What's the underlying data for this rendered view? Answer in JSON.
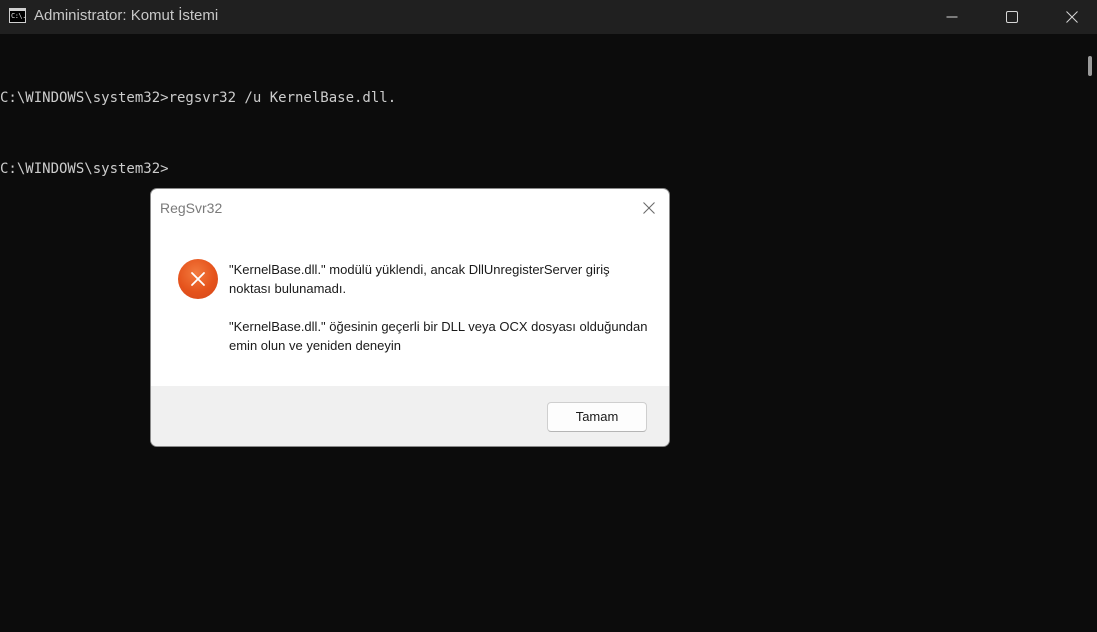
{
  "window": {
    "title": "Administrator: Komut İstemi",
    "icon_glyph": "C:\\."
  },
  "console": {
    "lines": [
      "C:\\WINDOWS\\system32>regsvr32 /u KernelBase.dll.",
      "C:\\WINDOWS\\system32>"
    ]
  },
  "dialog": {
    "title": "RegSvr32",
    "message_1": "\"KernelBase.dll.\" modülü yüklendi, ancak DllUnregisterServer giriş noktası bulunamadı.",
    "message_2": "\"KernelBase.dll.\" öğesinin geçerli bir DLL veya OCX dosyası olduğundan emin olun ve yeniden deneyin",
    "ok_label": "Tamam",
    "icon": "error-icon"
  },
  "colors": {
    "console_bg": "#0c0c0c",
    "titlebar_bg": "#202020",
    "error": "#e5531c"
  }
}
